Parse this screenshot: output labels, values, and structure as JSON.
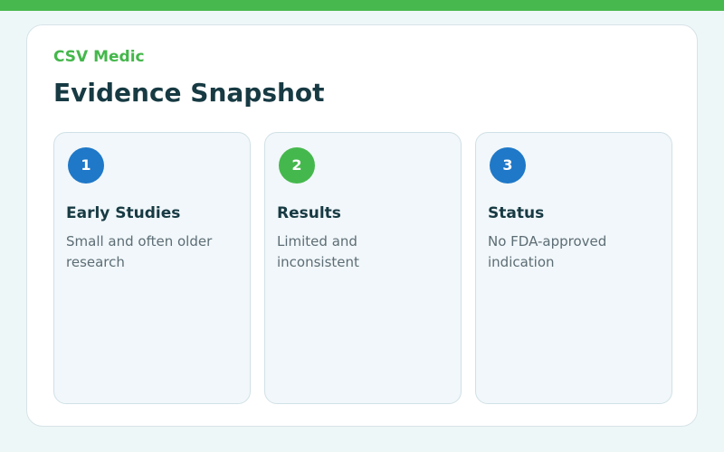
{
  "header": {
    "brand": "CSV Medic",
    "title": "Evidence Snapshot"
  },
  "cards": [
    {
      "number": "1",
      "title": "Early Studies",
      "text": "Small and often older research",
      "badge_color": "#1f78c8"
    },
    {
      "number": "2",
      "title": "Results",
      "text": "Limited and inconsistent",
      "badge_color": "#45b84d"
    },
    {
      "number": "3",
      "title": "Status",
      "text": "No FDA-approved indication",
      "badge_color": "#1f78c8"
    }
  ],
  "colors": {
    "accent": "#45b84d",
    "primary_blue": "#1f78c8",
    "heading": "#173a43",
    "body_text": "#5d6d75",
    "background": "#eef7f8",
    "card_background": "#f1f7fa"
  }
}
